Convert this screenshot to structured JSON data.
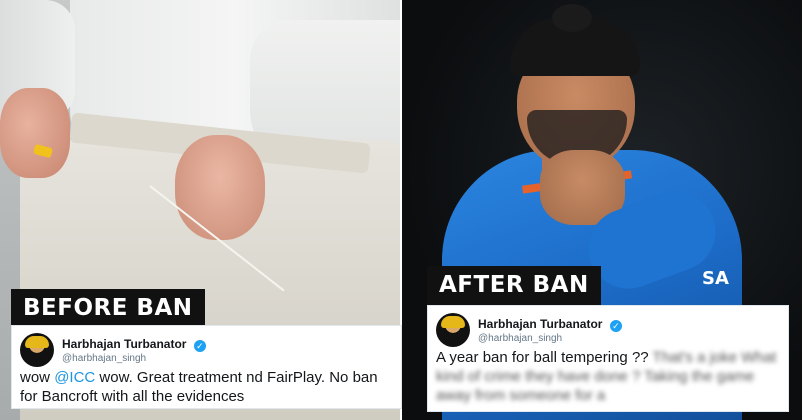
{
  "labels": {
    "before": "BEFORE BAN",
    "after": "AFTER BAN"
  },
  "tweet_before": {
    "display_name": "Harbhajan Turbanator",
    "handle": "@harbhajan_singh",
    "text_1": "wow ",
    "mention": "@ICC",
    "text_2": " wow. Great treatment nd FairPlay. No ban for Bancroft with all the evidences"
  },
  "tweet_after": {
    "display_name": "Harbhajan Turbanator",
    "handle": "@harbhajan_singh",
    "text_clear": "A year ban for ball tempering ?? ",
    "text_blurred": "That's a joke What kind of crime they have done ? Taking the game away from someone for a"
  },
  "jersey_text": "SA",
  "colors": {
    "twitter_blue": "#1da1f2",
    "mention": "#1b95e0",
    "label_bg": "#111111",
    "jersey": "#1c6bc7"
  },
  "icons": [
    "verified-icon"
  ]
}
